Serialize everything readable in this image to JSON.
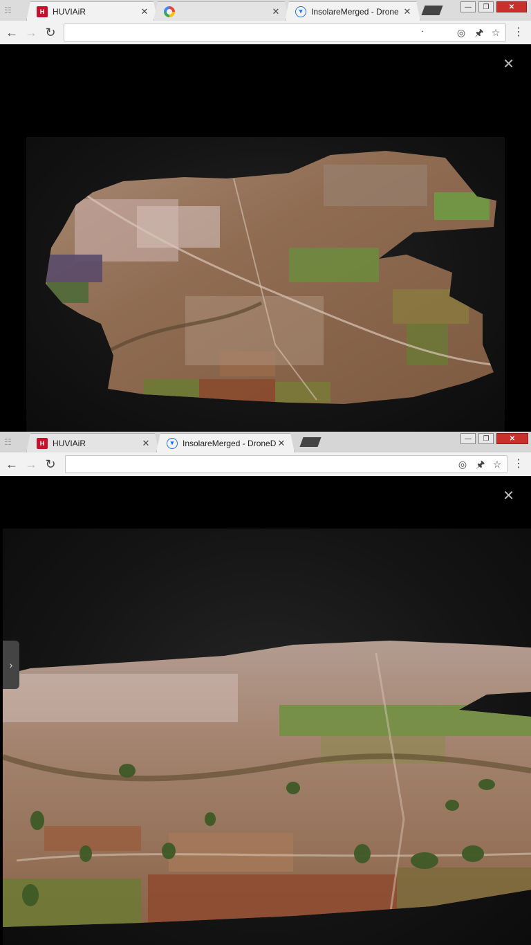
{
  "window1": {
    "tabs": [
      {
        "title": "HUVIAiR",
        "favicon": "huviair-logo",
        "close": "✕"
      },
      {
        "title": "",
        "favicon": "google-logo",
        "close": "✕"
      },
      {
        "title": "InsolareMerged - Drone",
        "favicon": "dronedeploy-logo",
        "close": "✕"
      }
    ],
    "controls": {
      "minimize": "—",
      "restore": "❐",
      "close": "✕"
    },
    "address": {
      "value": "",
      "dot": "·"
    },
    "viewer_close": "✕"
  },
  "window2": {
    "tabs": [
      {
        "title": "HUVIAiR",
        "favicon": "huviair-logo",
        "close": "✕"
      },
      {
        "title": "InsolareMerged - DroneD",
        "favicon": "dronedeploy-logo",
        "close": "✕"
      }
    ],
    "controls": {
      "minimize": "—",
      "restore": "❐",
      "close": "✕"
    },
    "address": {
      "value": ""
    },
    "viewer_close": "✕",
    "side_panel_toggle": "›"
  },
  "icons": {
    "back": "←",
    "forward": "→",
    "reload": "↻",
    "location": "◎",
    "extension": "🖈",
    "bookmark": "☆",
    "menu": "⋮",
    "apps": "☷"
  }
}
